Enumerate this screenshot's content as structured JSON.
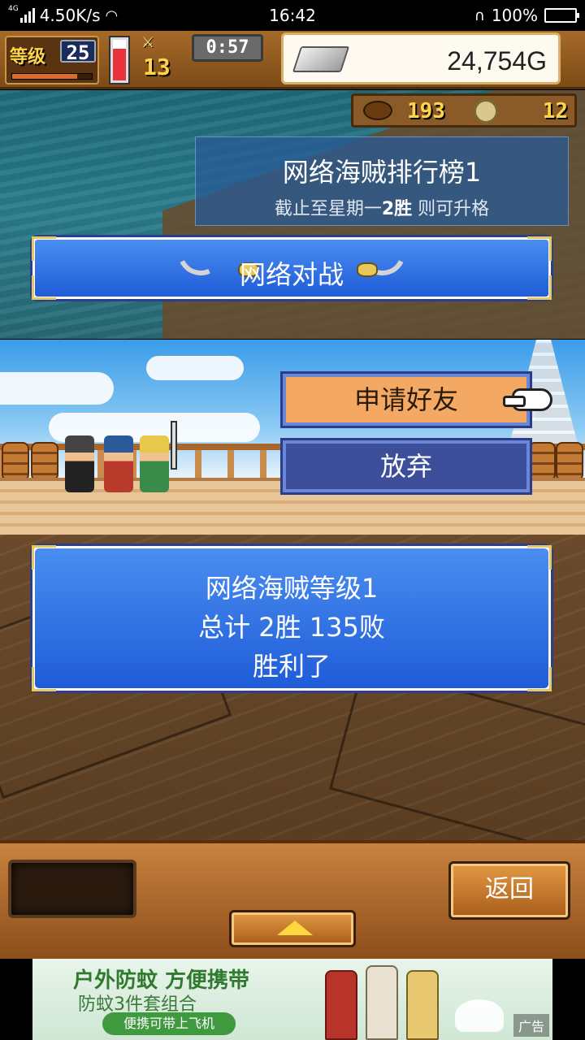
{
  "status_bar": {
    "network_type": "4G",
    "speed": "4.50K/s",
    "time": "16:42",
    "battery": "100%",
    "battery_level": 1.0
  },
  "hud": {
    "level_label": "等级",
    "level": "25",
    "xp_fraction": 0.82,
    "hp_fraction": 0.72,
    "crew_count": "13",
    "timer": "0:57",
    "gold": "24,754G",
    "stat_food": "193",
    "stat_coins": "12"
  },
  "ranking": {
    "title": "网络海贼排行榜1",
    "sub_prefix": "截止至星期一",
    "sub_wins": "2胜",
    "sub_suffix": " 则可升格"
  },
  "net_battle": {
    "label": "网络对战"
  },
  "actions": {
    "friend_label": "申请好友",
    "giveup_label": "放弃"
  },
  "result": {
    "line1": "网络海贼等级1",
    "line2": "总计 2胜 135败",
    "line3": "胜利了"
  },
  "toolbar": {
    "back_label": "返回"
  },
  "ad": {
    "headline": "户外防蚊  方便携带",
    "subline": "防蚊3件套组合",
    "pill": "便携可带上飞机",
    "tag": "广告"
  },
  "colors": {
    "blue_panel": "#1f5cd8",
    "friend_button": "#f3a964",
    "giveup_button": "#3d4f9a",
    "gold_text": "#ffd34a"
  }
}
